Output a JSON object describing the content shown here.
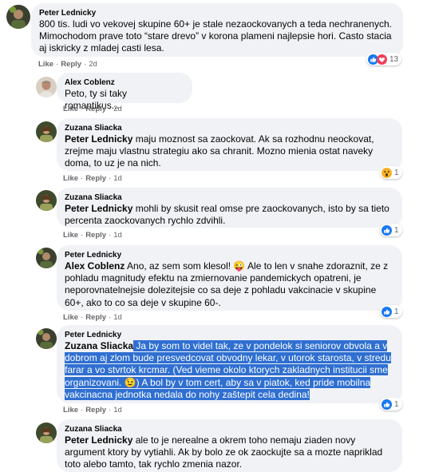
{
  "comments": [
    {
      "author": "Peter Lednicky",
      "text": "800 tis. ludi vo vekovej skupine 60+ je stale nezaockovanych a teda nechranenych. Mimochodom prave toto “stare drevo” v korona plameni najlepsie hori. Casto stacia aj iskricky z mladej casti lesa.",
      "like": "Like",
      "reply": "Reply",
      "time": "2d",
      "reaction_icons": [
        "like-reaction",
        "love-reaction"
      ],
      "reaction_count": "13"
    },
    {
      "author": "Alex Coblenz",
      "text": "Peto, ty si taky romantikus....",
      "like": "Like",
      "reply": "Reply",
      "time": "2d"
    },
    {
      "author": "Zuzana Sliacka",
      "mention": "Peter Lednicky",
      "text": " maju moznost sa zaockovat. Ak sa rozhodnu neockovat, zrejme maju vlastnu strategiu ako sa chranit. Mozno mienia ostat naveky doma, to uz je na nich.",
      "like": "Like",
      "reply": "Reply",
      "time": "1d",
      "reaction_icons": [
        "wow-reaction"
      ],
      "reaction_count": "1"
    },
    {
      "author": "Zuzana Sliacka",
      "mention": "Peter Lednicky",
      "text": " mohli by skusit real omse pre zaockovanych, isto by sa tieto percenta zaockovanych rychlo zdvihli.",
      "like": "Like",
      "reply": "Reply",
      "time": "1d",
      "reaction_icons": [
        "like-reaction"
      ],
      "reaction_count": "1"
    },
    {
      "author": "Peter Lednicky",
      "mention": "Alex Coblenz",
      "text_a": " Ano, az sem som klesol! ",
      "emoji": "😜",
      "text_b": " Ale to len v snahe zdoraznit, ze z pohladu magnitudy efektu na zmiernovanie pandemickych opatreni, je neporovnatelnejsie dolezitejsie co sa deje z pohladu vakcinacie v skupine 60+, ako to co sa deje v skupine 60-.",
      "like": "Like",
      "reply": "Reply",
      "time": "1d",
      "reaction_icons": [
        "like-reaction"
      ],
      "reaction_count": "1"
    },
    {
      "author": "Peter Lednicky",
      "mention": "Zuzana Sliacka",
      "text_a": " Ja by som to videl tak, ze v pondelok si seniorov obvola a v dobrom aj zlom bude presvedcovat obvodny lekar, v utorok starosta, v stredu farar a vo stvrtok krcmar. (Ved vieme okolo ktorych zakladnych institucii sme organizovani. ",
      "emoji": "😉",
      "text_b": ") A bol by v tom cert, aby sa v piatok, ked pride mobilna vakcinacna jednotka nedala do nohy zaštepit cela dedina!",
      "like": "Like",
      "reply": "Reply",
      "time": "1d",
      "reaction_icons": [
        "like-reaction"
      ],
      "reaction_count": "1"
    },
    {
      "author": "Zuzana Sliacka",
      "mention": "Peter Lednicky",
      "text": " ale to je nerealne a okrem toho nemaju ziaden novy argument ktory by vytiahli. Ak by bolo ze ok zaockujte sa a mozte napriklad toto alebo tamto, tak rychlo zmenia nazor."
    }
  ],
  "colors": {
    "bubble": "#f0f2f5",
    "meta": "#65676b",
    "selection": "#2f6fd1",
    "like_blue": "#1877f2",
    "love_red": "#f33e58",
    "wow_yellow": "#f7b125"
  }
}
